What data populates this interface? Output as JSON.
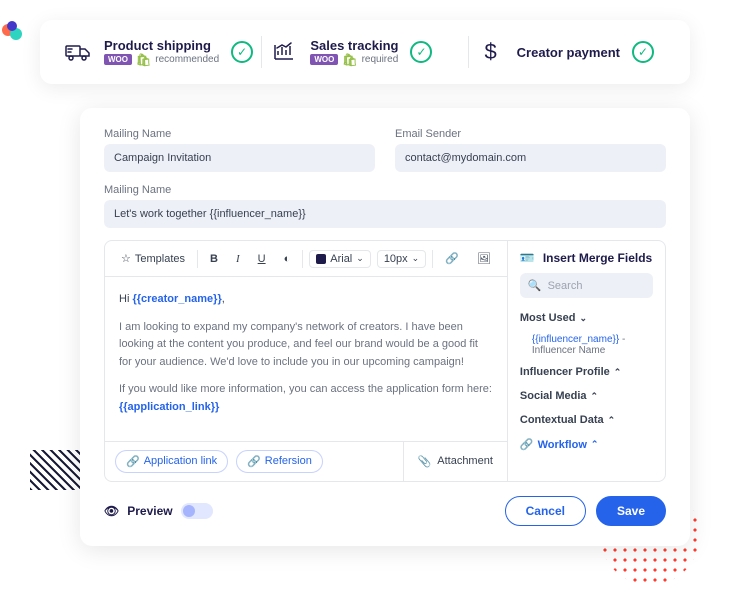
{
  "top": {
    "items": [
      {
        "title": "Product shipping",
        "sub": "recommended"
      },
      {
        "title": "Sales tracking",
        "sub": "required"
      },
      {
        "title": "Creator payment"
      }
    ]
  },
  "form": {
    "mailing_name_label": "Mailing Name",
    "mailing_name_value": "Campaign Invitation",
    "email_sender_label": "Email Sender",
    "email_sender_value": "contact@mydomain.com",
    "subject_label": "Mailing Name",
    "subject_value": "Let's work together {{influencer_name}}"
  },
  "toolbar": {
    "templates": "Templates",
    "font": "Arial",
    "size": "10px"
  },
  "body": {
    "greeting_pre": "Hi ",
    "greeting_tag": "{{creator_name}}",
    "greeting_post": ",",
    "p1": "I am looking to expand my company's network of creators. I have been looking at the content you produce, and feel our brand would be a good fit for your audience. We'd love to include you in our upcoming campaign!",
    "p2_pre": "If you would like more information, you can access the application form here: ",
    "p2_tag": "{{application_link}}"
  },
  "chips": {
    "app_link": "Application link",
    "refersion": "Refersion",
    "attachment": "Attachment"
  },
  "merge": {
    "title": "Insert Merge Fields",
    "search": "Search",
    "most_used": "Most Used",
    "item1_tag": "{{influencer_name}}",
    "item1_label": " - Influencer Name",
    "sections": [
      "Influencer Profile",
      "Social Media",
      "Contextual Data",
      "Workflow"
    ]
  },
  "bottom": {
    "preview": "Preview",
    "cancel": "Cancel",
    "save": "Save"
  }
}
